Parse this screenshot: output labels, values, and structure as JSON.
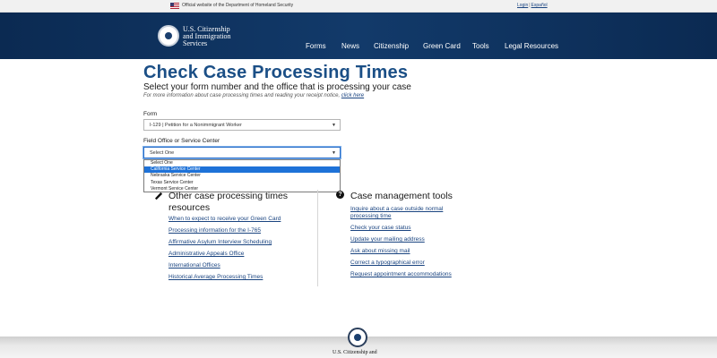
{
  "banner": {
    "text": "Official website of the Department of Homeland Security",
    "login": "Login",
    "separator": "|",
    "language": "Español"
  },
  "header": {
    "brand_line1": "U.S. Citizenship",
    "brand_line2": "and Immigration",
    "brand_line3": "Services",
    "nav": [
      "Forms",
      "News",
      "Citizenship",
      "Green Card",
      "Tools",
      "Legal Resources"
    ]
  },
  "main": {
    "title": "Check Case Processing Times",
    "subtitle": "Select your form number and the office that is processing your case",
    "hint_text": "For more information about case processing times and reading your receipt notice, ",
    "hint_link": "click here",
    "form_label": "Form",
    "form_value": "I-129 | Petition for a Nonimmigrant Worker",
    "office_label": "Field Office or Service Center",
    "office_value": "Select One",
    "office_options": [
      "Select One",
      "California Service Center",
      "Nebraska Service Center",
      "Texas Service Center",
      "Vermont Service Center"
    ],
    "highlighted_option": "California Service Center"
  },
  "resources": {
    "title_line1": "Other case processing times",
    "title_line2": "resources",
    "links": [
      "When to expect to receive your Green Card",
      "Processing information for the I-765",
      "Affirmative Asylum Interview Scheduling",
      "Administrative Appeals Office",
      "International Offices",
      "Historical Average Processing Times"
    ]
  },
  "tools": {
    "title": "Case management tools",
    "link0_line1": "Inquire about a case outside normal",
    "link0_line2": "processing time",
    "links": [
      "Check your case status",
      "Update your mailing address",
      "Ask about missing mail",
      "Correct a typographical error",
      "Request appointment accommodations"
    ]
  },
  "footer": {
    "brand": "U.S. Citizenship and"
  },
  "colors": {
    "header_bg": "#0b2a52",
    "title_blue": "#1b4f86",
    "link_blue": "#1a4480",
    "option_highlight": "#1e72d8"
  }
}
